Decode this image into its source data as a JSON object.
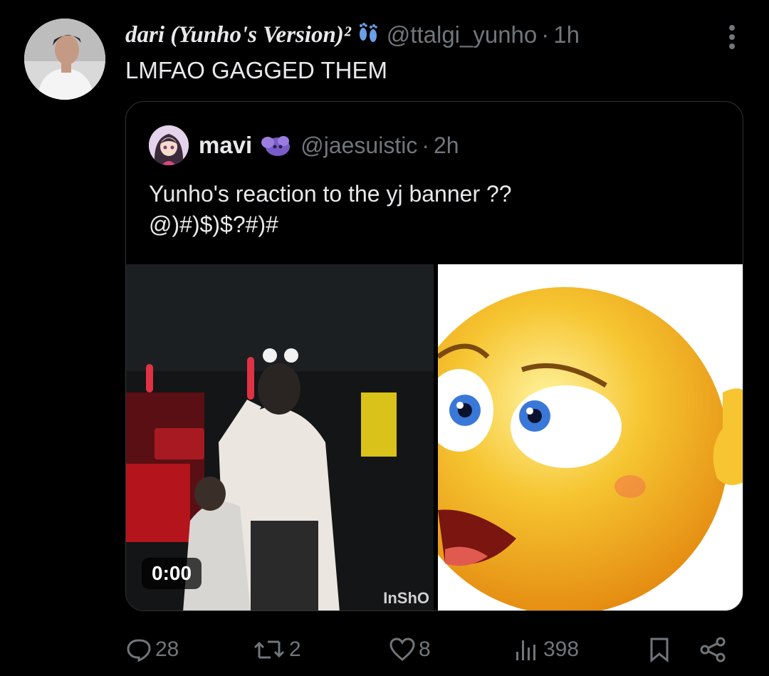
{
  "tweet": {
    "display_name": "dari (Yunho's Version)²",
    "handle": "@ttalgi_yunho",
    "separator": "·",
    "time": "1h",
    "text": "LMFAO GAGGED THEM"
  },
  "quoted": {
    "display_name": "mavi",
    "handle": "@jaesuistic",
    "separator": "·",
    "time": "2h",
    "text_line1": "Yunho's reaction to the yj banner ??",
    "text_line2": "@)#)$)$?#)#",
    "video_duration": "0:00",
    "video_watermark": "InShO"
  },
  "actions": {
    "replies": "28",
    "reposts": "2",
    "likes": "8",
    "views": "398"
  },
  "colors": {
    "background": "#000000",
    "text": "#e7e9ea",
    "muted": "#71767b",
    "border": "#2f3336"
  }
}
